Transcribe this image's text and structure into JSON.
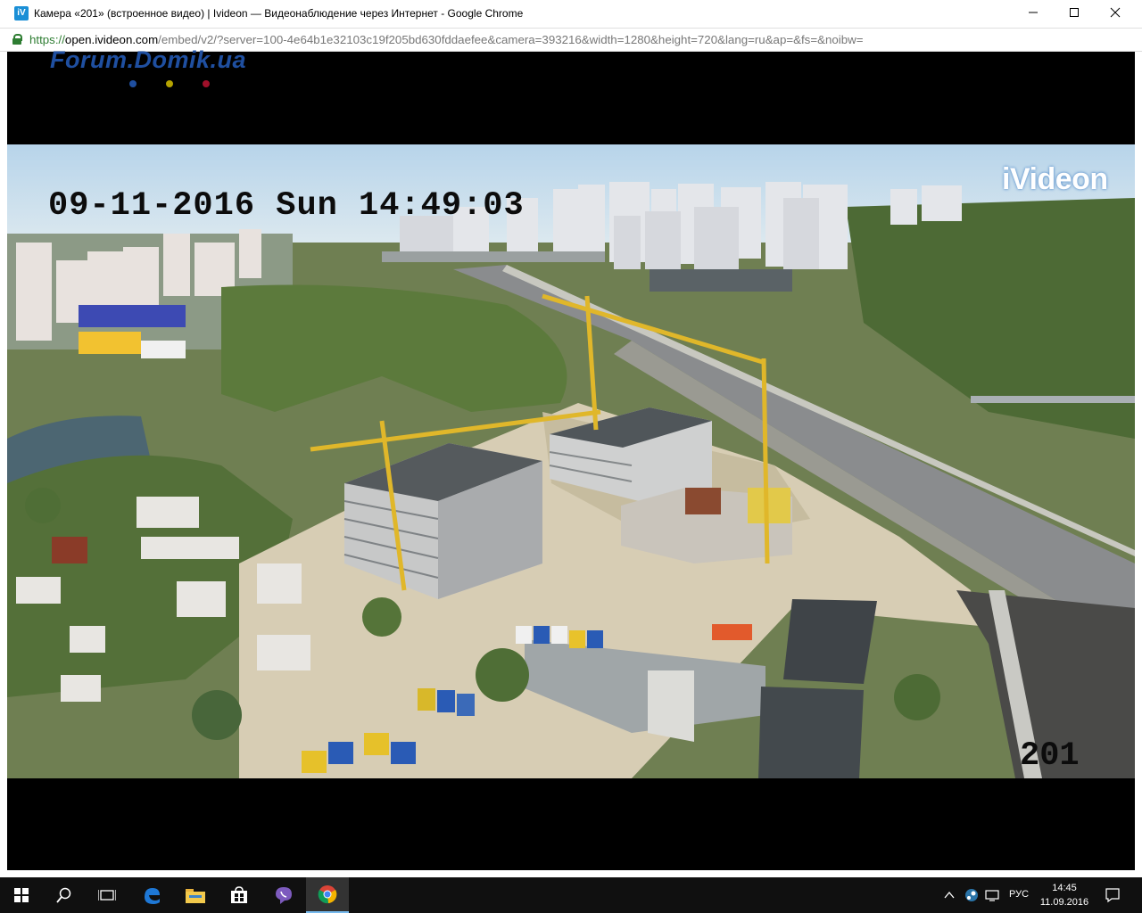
{
  "window": {
    "app_icon": "iV",
    "title": "Камера «201» (встроенное видео) | Ivideon — Видеонаблюдение через Интернет - Google Chrome",
    "minimize_icon": "minimize-icon",
    "maximize_icon": "maximize-icon",
    "close_icon": "close-icon"
  },
  "address_bar": {
    "scheme": "https://",
    "host": "open.ivideon.com",
    "path": "/embed/v2/?server=100-4e64b1e32103c19f205bd630fddaefee&camera=393216&width=1280&height=720&lang=ru&ap=&fs=&noibw=",
    "lock_icon": "lock-icon"
  },
  "watermark": {
    "text": "Forum.Domik.ua",
    "dot_colors": [
      "#1f4fa0",
      "#b5a300",
      "#a0102a"
    ]
  },
  "video": {
    "timestamp": "09-11-2016 Sun 14:49:03",
    "camera_number": "201",
    "brand": "iVideon"
  },
  "taskbar": {
    "items": [
      "start-icon",
      "search-icon",
      "task-view-icon",
      "edge-icon",
      "file-explorer-icon",
      "store-icon",
      "viber-icon",
      "chrome-icon"
    ],
    "language": "РУС",
    "time": "14:45",
    "date": "11.09.2016"
  },
  "colors": {
    "taskbar_bg": "#101010",
    "secure_green": "#2e7d32",
    "sky": "#cfe3f1"
  }
}
